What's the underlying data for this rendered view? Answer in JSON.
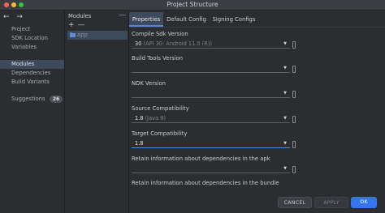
{
  "window": {
    "title": "Project Structure"
  },
  "nav": {
    "arrows": "← →",
    "items": [
      {
        "label": "Project"
      },
      {
        "label": "SDK Location"
      },
      {
        "label": "Variables"
      },
      {
        "label": "Modules"
      },
      {
        "label": "Dependencies"
      },
      {
        "label": "Build Variants"
      },
      {
        "label": "Suggestions",
        "badge": "26"
      }
    ]
  },
  "modules": {
    "header": "Modules",
    "collapse": "—",
    "add": "+",
    "remove": "—",
    "items": [
      {
        "label": "app"
      }
    ]
  },
  "tabs": [
    {
      "label": "Properties"
    },
    {
      "label": "Default Config"
    },
    {
      "label": "Signing Configs"
    }
  ],
  "fields": [
    {
      "label": "Compile Sdk Version",
      "value": "30",
      "hint": "(API 30: Android 11.0 (R))"
    },
    {
      "label": "Build Tools Version",
      "value": ""
    },
    {
      "label": "NDK Version",
      "value": ""
    },
    {
      "label": "Source Compatibility",
      "value": "1.8",
      "hint": "(Java 8)"
    },
    {
      "label": "Target Compatibility",
      "value": "1.8"
    },
    {
      "label": "Retain information about dependencies in the apk",
      "value": ""
    },
    {
      "label": "Retain information about dependencies in the bundle",
      "value": ""
    }
  ],
  "buttons": {
    "cancel": "CANCEL",
    "apply": "APPLY",
    "ok": "OK"
  },
  "colors": {
    "accent": "#3574f0",
    "selection": "#3d4a5b",
    "background": "#2b2d30"
  },
  "icons": {
    "nav_back": "arrow-left-icon",
    "nav_forward": "arrow-right-icon",
    "module": "folder-icon",
    "dropdown": "chevron-down-icon",
    "field_extra": "variable-marker-icon"
  }
}
